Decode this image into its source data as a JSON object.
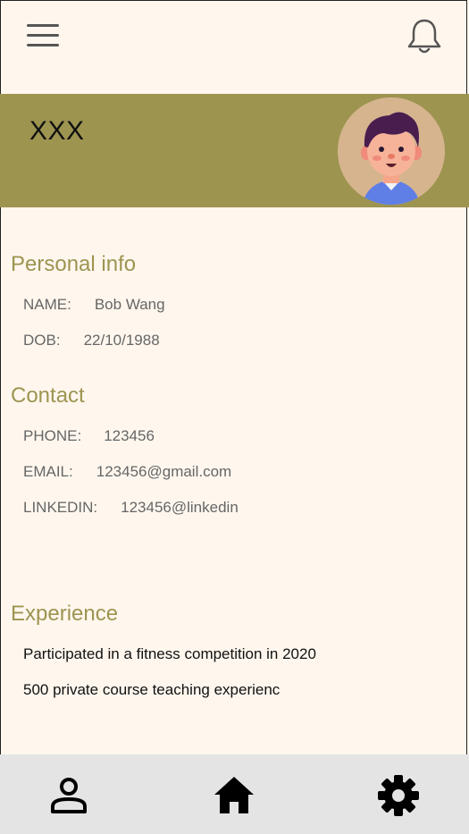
{
  "header": {
    "menu_icon": "hamburger-menu-icon",
    "notification_icon": "bell-icon"
  },
  "banner": {
    "title": "XXX",
    "background_color": "#9d9450",
    "avatar_icon": "cartoon-avatar"
  },
  "personal_info": {
    "heading": "Personal info",
    "name_label": "NAME:",
    "name_value": "Bob Wang",
    "dob_label": "DOB:",
    "dob_value": "22/10/1988"
  },
  "contact": {
    "heading": "Contact",
    "phone_label": "PHONE:",
    "phone_value": "123456",
    "email_label": "EMAIL:",
    "email_value": "123456@gmail.com",
    "linkedin_label": "LINKEDIN:",
    "linkedin_value": "123456@linkedin"
  },
  "experience": {
    "heading": "Experience",
    "items": [
      "Participated in a fitness competition in 2020",
      "500 private course teaching experienc"
    ]
  },
  "bottom_nav": {
    "items": [
      {
        "icon": "person-icon"
      },
      {
        "icon": "home-icon"
      },
      {
        "icon": "gear-icon"
      }
    ]
  },
  "colors": {
    "accent": "#9d9450",
    "background": "#fff7ee",
    "nav_background": "#e4e4e4"
  }
}
